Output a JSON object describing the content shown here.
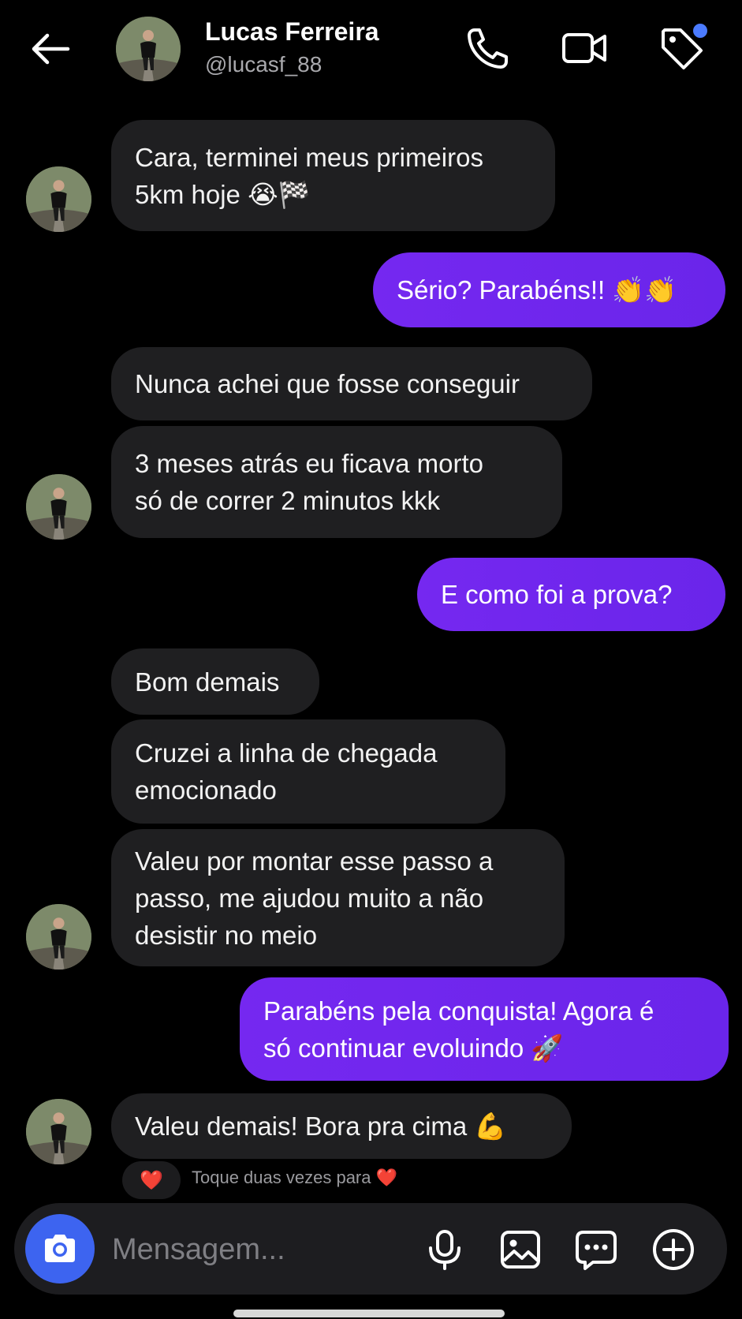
{
  "header": {
    "name": "Lucas Ferreira",
    "handle": "@lucasf_88",
    "back_icon": "arrow-left-icon",
    "icons": [
      "phone-icon",
      "video-icon",
      "tag-icon"
    ],
    "badge_color": "#4b7bff"
  },
  "messages": [
    {
      "from": "them",
      "text": "Cara, terminei meus primeiros\n5km hoje 😭🏁"
    },
    {
      "from": "me",
      "text": "Sério? Parabéns!! 👏👏"
    },
    {
      "from": "them",
      "text": "Nunca achei que fosse conseguir"
    },
    {
      "from": "them",
      "text": "3 meses atrás eu ficava morto\nsó de correr 2 minutos kkk"
    },
    {
      "from": "me",
      "text": "E como foi a prova?"
    },
    {
      "from": "them",
      "text": "Bom demais"
    },
    {
      "from": "them",
      "text": "Cruzei a linha de chegada\nemocionado"
    },
    {
      "from": "them",
      "text": "Valeu por montar esse passo a\npasso, me ajudou muito a não\ndesistir no meio"
    },
    {
      "from": "me",
      "text": "Parabéns pela conquista! Agora é\nsó continuar evoluindo 🚀"
    },
    {
      "from": "them",
      "text": "Valeu demais! Bora pra cima 💪"
    }
  ],
  "reaction": {
    "emoji": "❤️",
    "hint": "Toque duas vezes para ❤️"
  },
  "composer": {
    "placeholder": "Mensagem...",
    "icons": [
      "camera-icon",
      "microphone-icon",
      "image-icon",
      "chat-bubble-icon",
      "plus-circle-icon"
    ]
  },
  "colors": {
    "background": "#000000",
    "incoming_bubble": "#1f1f21",
    "outgoing_bubble": "#7528f0",
    "camera_button": "#3d64f0"
  }
}
